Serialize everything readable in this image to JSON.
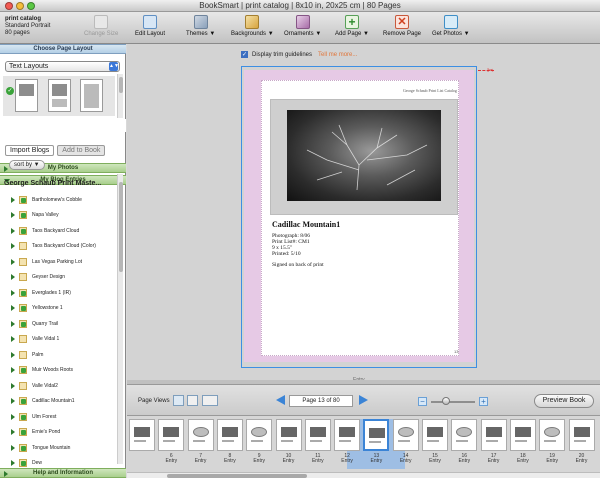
{
  "window": {
    "title": "BookSmart  |  print catalog  |  8x10 in, 20x25 cm  |  80 Pages"
  },
  "book_info": {
    "name": "print catalog",
    "layout": "Standard Portrait",
    "pages": "80 pages"
  },
  "toolbar": {
    "change_size": "Change Size",
    "edit_layout": "Edit Layout",
    "themes": "Themes ▼",
    "backgrounds": "Backgrounds ▼",
    "ornaments": "Ornaments ▼",
    "add_page": "Add Page ▼",
    "remove_page": "Remove Page",
    "get_photos": "Get Photos ▼"
  },
  "sidebar": {
    "choose_layout": "Choose Page Layout",
    "layout_select": "Text Layouts",
    "my_photos": "My Photos",
    "my_blog_entries": "My Blog Entries",
    "import_blogs": "Import Blogs",
    "add_to_book": "Add to Book",
    "sort_by": "sort by ▼",
    "blog_root": "George Schaub Print Maste...",
    "blog_items": [
      {
        "label": "Bartholomew's Cobble",
        "checked": true
      },
      {
        "label": "Napa Valley",
        "checked": true
      },
      {
        "label": "Taos Backyard Cloud",
        "checked": true
      },
      {
        "label": "Taos Backyard Cloud (Color)",
        "checked": false
      },
      {
        "label": "Las Vegas Parking Lot",
        "checked": false
      },
      {
        "label": "Geyser Design",
        "checked": false
      },
      {
        "label": "Everglades 1 (IR)",
        "checked": true
      },
      {
        "label": "Yellowstone 1",
        "checked": true
      },
      {
        "label": "Quarry Trail",
        "checked": true
      },
      {
        "label": "Valle Vidal 1",
        "checked": false
      },
      {
        "label": "Palm",
        "checked": false
      },
      {
        "label": "Muir Woods Roots",
        "checked": true
      },
      {
        "label": "Valle Vidal2",
        "checked": false
      },
      {
        "label": "Cadillac Mountain1",
        "checked": true
      },
      {
        "label": "Ulm Forest",
        "checked": true
      },
      {
        "label": "Ernie's Pond",
        "checked": true
      },
      {
        "label": "Tongue Mountain",
        "checked": true
      },
      {
        "label": "Dew",
        "checked": true
      }
    ],
    "help": "Help and Information"
  },
  "canvas": {
    "trim_label": "Display trim guidelines",
    "tell_more": "Tell me more...",
    "header": "George Schaub Print List Catalog",
    "caption_title": "Cadillac Mountain1",
    "caption_lines": [
      "Photograph: 8/06",
      "Print List#: CM1",
      "9 x 15.5\"",
      "Printed: 5/10"
    ],
    "caption_note": "Signed on back of print",
    "page_number": "13",
    "entry_label": "Entry"
  },
  "pageviews": {
    "label": "Page Views",
    "page_indicator": "Page 13 of 80",
    "preview_button": "Preview Book",
    "zoom_level": 0.35
  },
  "filmstrip": {
    "pages": [
      {
        "num": "",
        "label": "",
        "img": "dark"
      },
      {
        "num": "6",
        "label": "Entry",
        "img": "dark"
      },
      {
        "num": "7",
        "label": "Entry",
        "img": "light"
      },
      {
        "num": "8",
        "label": "Entry",
        "img": "dark"
      },
      {
        "num": "9",
        "label": "Entry",
        "img": "light"
      },
      {
        "num": "10",
        "label": "Entry",
        "img": "dark"
      },
      {
        "num": "11",
        "label": "Entry",
        "img": "dark"
      },
      {
        "num": "12",
        "label": "Entry",
        "img": "dark"
      },
      {
        "num": "13",
        "label": "Entry",
        "img": "dark"
      },
      {
        "num": "14",
        "label": "Entry",
        "img": "light"
      },
      {
        "num": "15",
        "label": "Entry",
        "img": "dark"
      },
      {
        "num": "16",
        "label": "Entry",
        "img": "light"
      },
      {
        "num": "17",
        "label": "Entry",
        "img": "dark"
      },
      {
        "num": "18",
        "label": "Entry",
        "img": "dark"
      },
      {
        "num": "19",
        "label": "Entry",
        "img": "light"
      },
      {
        "num": "20",
        "label": "Entry",
        "img": "dark"
      }
    ],
    "selected": [
      "12",
      "13"
    ]
  },
  "colors": {
    "accent": "#3b84d6",
    "sidebar_green": "#a9cf8d",
    "bleed_pink": "#e6c9e5",
    "link_orange": "#e0763b"
  }
}
